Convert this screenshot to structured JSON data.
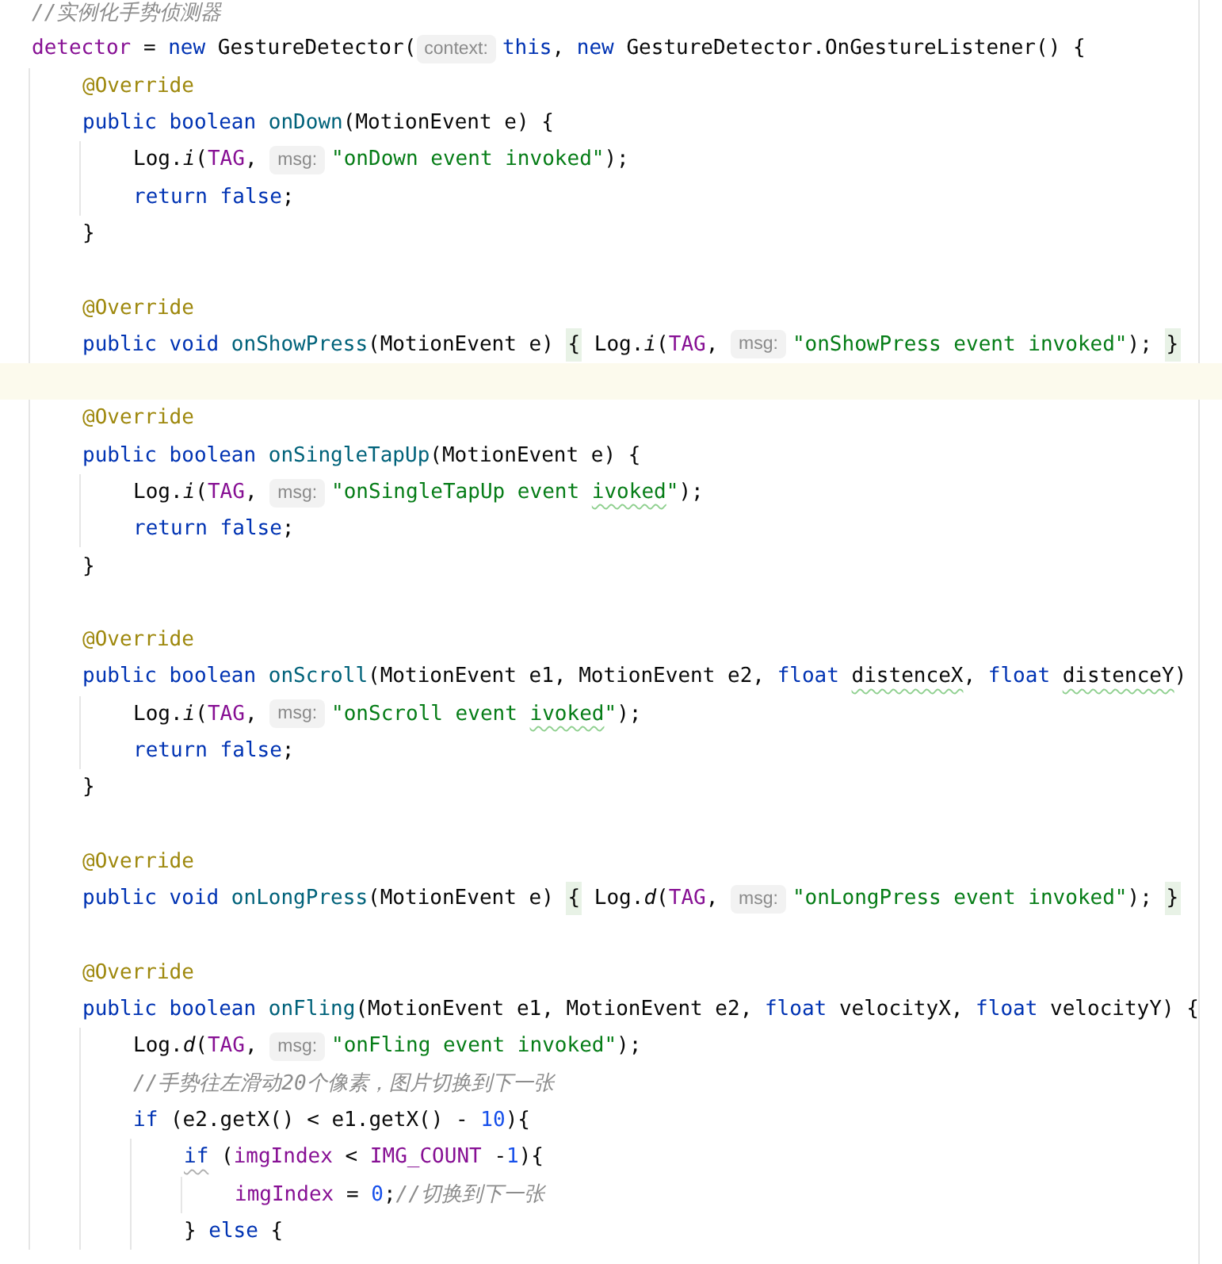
{
  "code": {
    "lines": [
      {
        "kind": "code",
        "tokens": [
          {
            "kind": "comment",
            "text": "//实例化手势侦测器"
          }
        ]
      },
      {
        "kind": "code",
        "tokens": [
          {
            "kind": "field",
            "text": "detector"
          },
          {
            "kind": "plain",
            "text": " = "
          },
          {
            "kind": "keyword",
            "text": "new"
          },
          {
            "kind": "plain",
            "text": " GestureDetector("
          },
          {
            "kind": "hint",
            "text": "context:"
          },
          {
            "kind": "keyword",
            "text": "this"
          },
          {
            "kind": "plain",
            "text": ", "
          },
          {
            "kind": "keyword",
            "text": "new"
          },
          {
            "kind": "plain",
            "text": " GestureDetector.OnGestureListener() {"
          }
        ],
        "children": [
          {
            "kind": "code",
            "tokens": [
              {
                "kind": "annotation",
                "text": "@Override"
              }
            ]
          },
          {
            "kind": "code",
            "tokens": [
              {
                "kind": "keyword",
                "text": "public boolean "
              },
              {
                "kind": "method",
                "text": "onDown"
              },
              {
                "kind": "plain",
                "text": "(MotionEvent e) {"
              }
            ],
            "children": [
              {
                "kind": "code",
                "tokens": [
                  {
                    "kind": "plain",
                    "text": "Log."
                  },
                  {
                    "kind": "static_call",
                    "text": "i"
                  },
                  {
                    "kind": "plain",
                    "text": "("
                  },
                  {
                    "kind": "field",
                    "text": "TAG"
                  },
                  {
                    "kind": "plain",
                    "text": ", "
                  },
                  {
                    "kind": "hint",
                    "text": "msg:"
                  },
                  {
                    "kind": "string",
                    "text": "\"onDown event invoked\""
                  },
                  {
                    "kind": "plain",
                    "text": ");"
                  }
                ]
              },
              {
                "kind": "code",
                "tokens": [
                  {
                    "kind": "keyword",
                    "text": "return false"
                  },
                  {
                    "kind": "plain",
                    "text": ";"
                  }
                ]
              }
            ]
          },
          {
            "kind": "code",
            "tokens": [
              {
                "kind": "plain",
                "text": "}"
              }
            ]
          },
          {
            "kind": "blank"
          },
          {
            "kind": "code",
            "tokens": [
              {
                "kind": "annotation",
                "text": "@Override"
              }
            ]
          },
          {
            "kind": "code",
            "tokens": [
              {
                "kind": "keyword",
                "text": "public void "
              },
              {
                "kind": "method",
                "text": "onShowPress"
              },
              {
                "kind": "plain",
                "text": "(MotionEvent e) "
              },
              {
                "kind": "fold",
                "text": "{"
              },
              {
                "kind": "plain",
                "text": " Log."
              },
              {
                "kind": "static_call",
                "text": "i"
              },
              {
                "kind": "plain",
                "text": "("
              },
              {
                "kind": "field",
                "text": "TAG"
              },
              {
                "kind": "plain",
                "text": ", "
              },
              {
                "kind": "hint",
                "text": "msg:"
              },
              {
                "kind": "string",
                "text": "\"onShowPress event invoked\""
              },
              {
                "kind": "plain",
                "text": "); "
              },
              {
                "kind": "fold",
                "text": "}"
              }
            ]
          },
          {
            "kind": "blank",
            "current": true
          },
          {
            "kind": "code",
            "tokens": [
              {
                "kind": "annotation",
                "text": "@Override"
              }
            ]
          },
          {
            "kind": "code",
            "tokens": [
              {
                "kind": "keyword",
                "text": "public boolean "
              },
              {
                "kind": "method",
                "text": "onSingleTapUp"
              },
              {
                "kind": "plain",
                "text": "(MotionEvent e) {"
              }
            ],
            "children": [
              {
                "kind": "code",
                "tokens": [
                  {
                    "kind": "plain",
                    "text": "Log."
                  },
                  {
                    "kind": "static_call",
                    "text": "i"
                  },
                  {
                    "kind": "plain",
                    "text": "("
                  },
                  {
                    "kind": "field",
                    "text": "TAG"
                  },
                  {
                    "kind": "plain",
                    "text": ", "
                  },
                  {
                    "kind": "hint",
                    "text": "msg:"
                  },
                  {
                    "kind": "string",
                    "text": "\"onSingleTapUp event "
                  },
                  {
                    "kind": "string",
                    "text": "ivoked",
                    "misspelled": true
                  },
                  {
                    "kind": "string",
                    "text": "\""
                  },
                  {
                    "kind": "plain",
                    "text": ");"
                  }
                ]
              },
              {
                "kind": "code",
                "tokens": [
                  {
                    "kind": "keyword",
                    "text": "return false"
                  },
                  {
                    "kind": "plain",
                    "text": ";"
                  }
                ]
              }
            ]
          },
          {
            "kind": "code",
            "tokens": [
              {
                "kind": "plain",
                "text": "}"
              }
            ]
          },
          {
            "kind": "blank"
          },
          {
            "kind": "code",
            "tokens": [
              {
                "kind": "annotation",
                "text": "@Override"
              }
            ]
          },
          {
            "kind": "code",
            "tokens": [
              {
                "kind": "keyword",
                "text": "public boolean "
              },
              {
                "kind": "method",
                "text": "onScroll"
              },
              {
                "kind": "plain",
                "text": "(MotionEvent e1, MotionEvent e2, "
              },
              {
                "kind": "keyword",
                "text": "float "
              },
              {
                "kind": "plain",
                "text": "distenceX",
                "misspelled": true
              },
              {
                "kind": "plain",
                "text": ", "
              },
              {
                "kind": "keyword",
                "text": "float "
              },
              {
                "kind": "plain",
                "text": "distenceY",
                "misspelled": true
              },
              {
                "kind": "plain",
                "text": ")"
              }
            ],
            "children": [
              {
                "kind": "code",
                "tokens": [
                  {
                    "kind": "plain",
                    "text": "Log."
                  },
                  {
                    "kind": "static_call",
                    "text": "i"
                  },
                  {
                    "kind": "plain",
                    "text": "("
                  },
                  {
                    "kind": "field",
                    "text": "TAG"
                  },
                  {
                    "kind": "plain",
                    "text": ", "
                  },
                  {
                    "kind": "hint",
                    "text": "msg:"
                  },
                  {
                    "kind": "string",
                    "text": "\"onScroll event "
                  },
                  {
                    "kind": "string",
                    "text": "ivoked",
                    "misspelled": true
                  },
                  {
                    "kind": "string",
                    "text": "\""
                  },
                  {
                    "kind": "plain",
                    "text": ");"
                  }
                ]
              },
              {
                "kind": "code",
                "tokens": [
                  {
                    "kind": "keyword",
                    "text": "return false"
                  },
                  {
                    "kind": "plain",
                    "text": ";"
                  }
                ]
              }
            ]
          },
          {
            "kind": "code",
            "tokens": [
              {
                "kind": "plain",
                "text": "}"
              }
            ]
          },
          {
            "kind": "blank"
          },
          {
            "kind": "code",
            "tokens": [
              {
                "kind": "annotation",
                "text": "@Override"
              }
            ]
          },
          {
            "kind": "code",
            "tokens": [
              {
                "kind": "keyword",
                "text": "public void "
              },
              {
                "kind": "method",
                "text": "onLongPress"
              },
              {
                "kind": "plain",
                "text": "(MotionEvent e) "
              },
              {
                "kind": "fold",
                "text": "{"
              },
              {
                "kind": "plain",
                "text": " Log."
              },
              {
                "kind": "static_call",
                "text": "d"
              },
              {
                "kind": "plain",
                "text": "("
              },
              {
                "kind": "field",
                "text": "TAG"
              },
              {
                "kind": "plain",
                "text": ", "
              },
              {
                "kind": "hint",
                "text": "msg:"
              },
              {
                "kind": "string",
                "text": "\"onLongPress event invoked\""
              },
              {
                "kind": "plain",
                "text": "); "
              },
              {
                "kind": "fold",
                "text": "}"
              }
            ]
          },
          {
            "kind": "blank"
          },
          {
            "kind": "code",
            "tokens": [
              {
                "kind": "annotation",
                "text": "@Override"
              }
            ]
          },
          {
            "kind": "code",
            "tokens": [
              {
                "kind": "keyword",
                "text": "public boolean "
              },
              {
                "kind": "method",
                "text": "onFling"
              },
              {
                "kind": "plain",
                "text": "(MotionEvent e1, MotionEvent e2, "
              },
              {
                "kind": "keyword",
                "text": "float "
              },
              {
                "kind": "plain",
                "text": "velocityX, "
              },
              {
                "kind": "keyword",
                "text": "float "
              },
              {
                "kind": "plain",
                "text": "velocityY) {"
              }
            ],
            "children": [
              {
                "kind": "code",
                "tokens": [
                  {
                    "kind": "plain",
                    "text": "Log."
                  },
                  {
                    "kind": "static_call",
                    "text": "d"
                  },
                  {
                    "kind": "plain",
                    "text": "("
                  },
                  {
                    "kind": "field",
                    "text": "TAG"
                  },
                  {
                    "kind": "plain",
                    "text": ", "
                  },
                  {
                    "kind": "hint",
                    "text": "msg:"
                  },
                  {
                    "kind": "string",
                    "text": "\"onFling event invoked\""
                  },
                  {
                    "kind": "plain",
                    "text": ");"
                  }
                ]
              },
              {
                "kind": "code",
                "tokens": [
                  {
                    "kind": "comment",
                    "text": "//手势往左滑动20个像素，图片切换到下一张"
                  }
                ]
              },
              {
                "kind": "code",
                "tokens": [
                  {
                    "kind": "keyword",
                    "text": "if"
                  },
                  {
                    "kind": "plain",
                    "text": " (e2.getX() < e1.getX() - "
                  },
                  {
                    "kind": "number",
                    "text": "10"
                  },
                  {
                    "kind": "plain",
                    "text": "){"
                  }
                ],
                "children": [
                  {
                    "kind": "code",
                    "tokens": [
                      {
                        "kind": "keyword",
                        "text": "if",
                        "warning": true
                      },
                      {
                        "kind": "plain",
                        "text": " ("
                      },
                      {
                        "kind": "field",
                        "text": "imgIndex"
                      },
                      {
                        "kind": "plain",
                        "text": " < "
                      },
                      {
                        "kind": "field",
                        "text": "IMG_COUNT"
                      },
                      {
                        "kind": "plain",
                        "text": " -"
                      },
                      {
                        "kind": "number",
                        "text": "1"
                      },
                      {
                        "kind": "plain",
                        "text": "){"
                      }
                    ],
                    "children": [
                      {
                        "kind": "code",
                        "tokens": [
                          {
                            "kind": "field",
                            "text": "imgIndex"
                          },
                          {
                            "kind": "plain",
                            "text": " = "
                          },
                          {
                            "kind": "number",
                            "text": "0"
                          },
                          {
                            "kind": "plain",
                            "text": ";"
                          },
                          {
                            "kind": "comment",
                            "text": "//切换到下一张"
                          }
                        ]
                      }
                    ]
                  },
                  {
                    "kind": "code",
                    "tokens": [
                      {
                        "kind": "plain",
                        "text": "} "
                      },
                      {
                        "kind": "keyword",
                        "text": "else"
                      },
                      {
                        "kind": "plain",
                        "text": " {"
                      }
                    ]
                  }
                ]
              }
            ]
          }
        ]
      }
    ]
  }
}
